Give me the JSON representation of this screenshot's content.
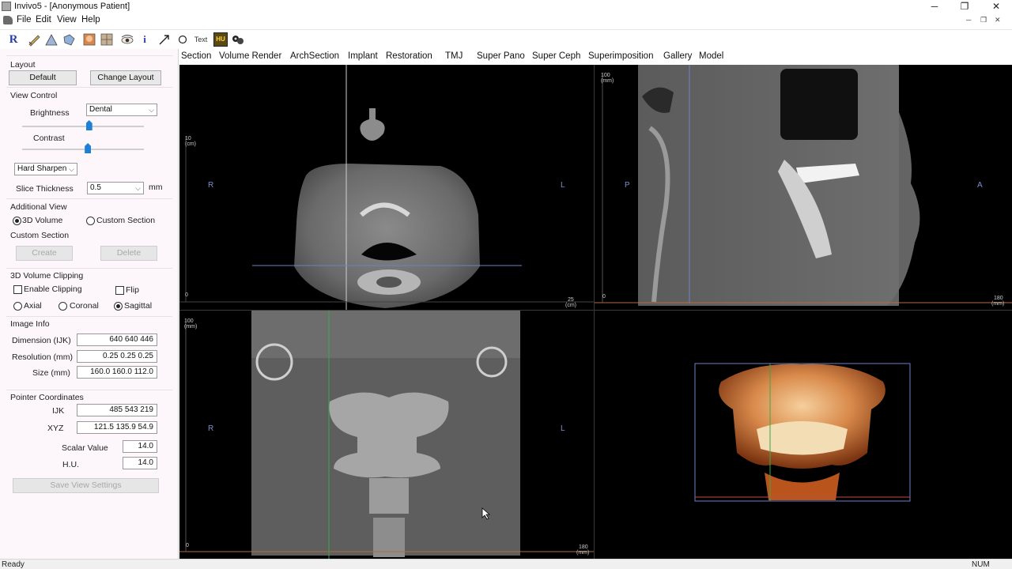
{
  "window": {
    "title": "Invivo5 - [Anonymous Patient]",
    "min": "─",
    "restore": "❐",
    "close": "✕"
  },
  "menu": {
    "items": [
      "File",
      "Edit",
      "View",
      "Help"
    ],
    "mdi_min": "─",
    "mdi_restore": "❐",
    "mdi_close": "✕"
  },
  "toolbar": {
    "r_label": "R",
    "info_label": "i",
    "text_label": "Text",
    "hu_label": "HU"
  },
  "left": {
    "layout": {
      "header": "Layout",
      "default": "Default",
      "change": "Change Layout"
    },
    "view_control": {
      "header": "View Control",
      "brightness": "Brightness",
      "preset": "Dental",
      "contrast": "Contrast",
      "brightness_level": 0.55,
      "contrast_level": 0.54,
      "filter": "Hard Sharpen",
      "slice_thickness_label": "Slice Thickness",
      "slice_thickness": "0.5",
      "unit": "mm"
    },
    "additional_view": {
      "header": "Additional View",
      "volume": "3D Volume",
      "custom": "Custom Section"
    },
    "custom_section": {
      "header": "Custom Section",
      "create": "Create",
      "delete": "Delete"
    },
    "clipping": {
      "header": "3D Volume Clipping",
      "enable": "Enable Clipping",
      "flip": "Flip",
      "axial": "Axial",
      "coronal": "Coronal",
      "sagittal": "Sagittal"
    },
    "image_info": {
      "header": "Image Info",
      "dimension_label": "Dimension (IJK)",
      "dimension": "640  640  446",
      "resolution_label": "Resolution (mm)",
      "resolution": "0.25  0.25  0.25",
      "size_label": "Size (mm)",
      "size": "160.0  160.0  112.0"
    },
    "pointer": {
      "header": "Pointer Coordinates",
      "ijk_label": "IJK",
      "ijk": "485  543  219",
      "xyz_label": "XYZ",
      "xyz": "121.5  135.9  54.9",
      "scalar_label": "Scalar Value",
      "scalar": "14.0",
      "hu_label": "H.U.",
      "hu": "14.0"
    },
    "save": "Save View Settings"
  },
  "tabs": [
    "Section",
    "Volume Render",
    "ArchSection",
    "Implant",
    "Restoration",
    "TMJ",
    "Super Pano",
    "Super Ceph",
    "Superimposition",
    "Gallery",
    "Model"
  ],
  "views": {
    "axial": {
      "left": "R",
      "right": "L",
      "scale_top": "10",
      "scale_unit": "(cm)",
      "scale_zero": "0",
      "scale_end": "25",
      "scale_end_unit": "(cm)"
    },
    "sagittal": {
      "left": "P",
      "right": "A",
      "scale_top": "100",
      "scale_unit": "(mm)",
      "scale_zero": "0",
      "scale_end": "180",
      "scale_end_unit": "(mm)"
    },
    "coronal": {
      "left": "R",
      "right": "L",
      "scale_top": "100",
      "scale_unit": "(mm)",
      "scale_zero": "0",
      "scale_end": "180",
      "scale_end_unit": "(mm)"
    }
  },
  "status": {
    "left": "Ready",
    "right": "NUM"
  }
}
